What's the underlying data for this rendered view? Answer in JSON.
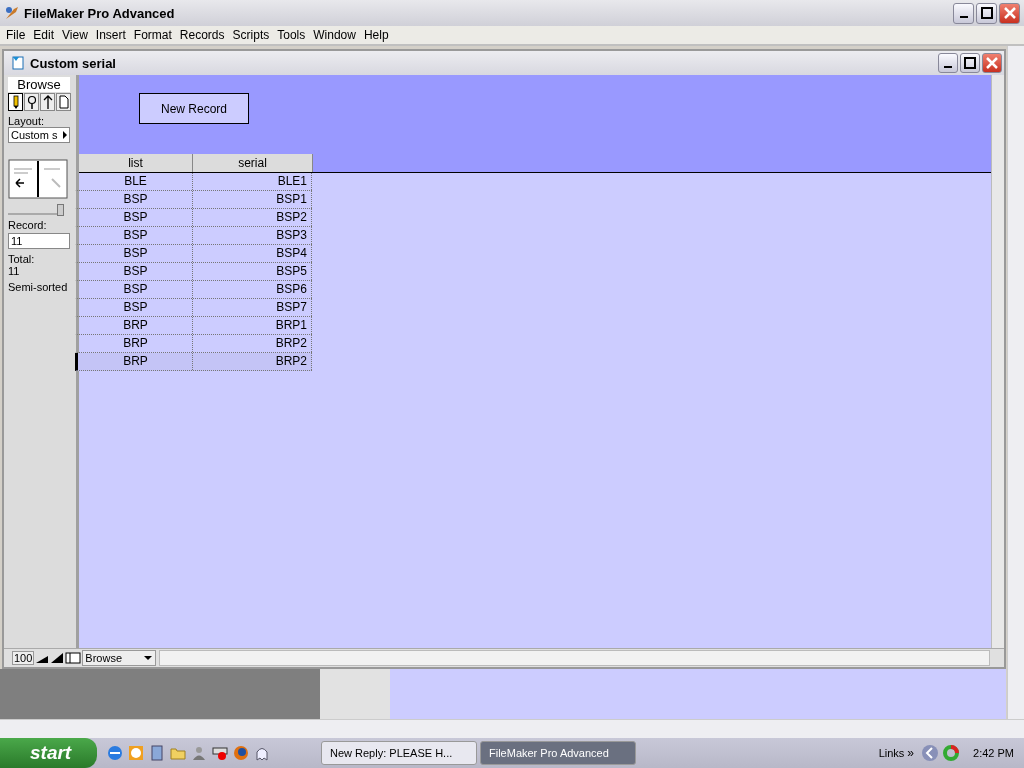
{
  "window": {
    "title": "FileMaker Pro Advanced"
  },
  "menu": [
    "File",
    "Edit",
    "View",
    "Insert",
    "Format",
    "Records",
    "Scripts",
    "Tools",
    "Window",
    "Help"
  ],
  "document": {
    "title": "Custom serial"
  },
  "status_area": {
    "mode": "Browse",
    "layout_label": "Layout:",
    "layout_value": "Custom s",
    "record_label": "Record:",
    "record_value": "11",
    "total_label": "Total:",
    "total_value": "11",
    "sort_state": "Semi-sorted",
    "slider": {
      "level": 1
    }
  },
  "button": {
    "label": "New Record"
  },
  "table": {
    "columns": [
      "list",
      "serial"
    ],
    "rows": [
      {
        "cells": [
          "BLE",
          "BLE1"
        ],
        "selected": false
      },
      {
        "cells": [
          "BSP",
          "BSP1"
        ],
        "selected": false
      },
      {
        "cells": [
          "BSP",
          "BSP2"
        ],
        "selected": false
      },
      {
        "cells": [
          "BSP",
          "BSP3"
        ],
        "selected": false
      },
      {
        "cells": [
          "BSP",
          "BSP4"
        ],
        "selected": false
      },
      {
        "cells": [
          "BSP",
          "BSP5"
        ],
        "selected": false
      },
      {
        "cells": [
          "BSP",
          "BSP6"
        ],
        "selected": false
      },
      {
        "cells": [
          "BSP",
          "BSP7"
        ],
        "selected": false
      },
      {
        "cells": [
          "BRP",
          "BRP1"
        ],
        "selected": false
      },
      {
        "cells": [
          "BRP",
          "BRP2"
        ],
        "selected": false
      },
      {
        "cells": [
          "BRP",
          "BRP2"
        ],
        "selected": true
      }
    ]
  },
  "footer": {
    "zoom": "100",
    "mode": "Browse"
  },
  "taskbar": {
    "start": "start",
    "tasks": [
      {
        "label": "New Reply: PLEASE H...",
        "selected": false
      },
      {
        "label": "FileMaker Pro Advanced",
        "selected": true
      }
    ],
    "links": "Links",
    "chevron": "»",
    "clock": "2:42 PM"
  }
}
